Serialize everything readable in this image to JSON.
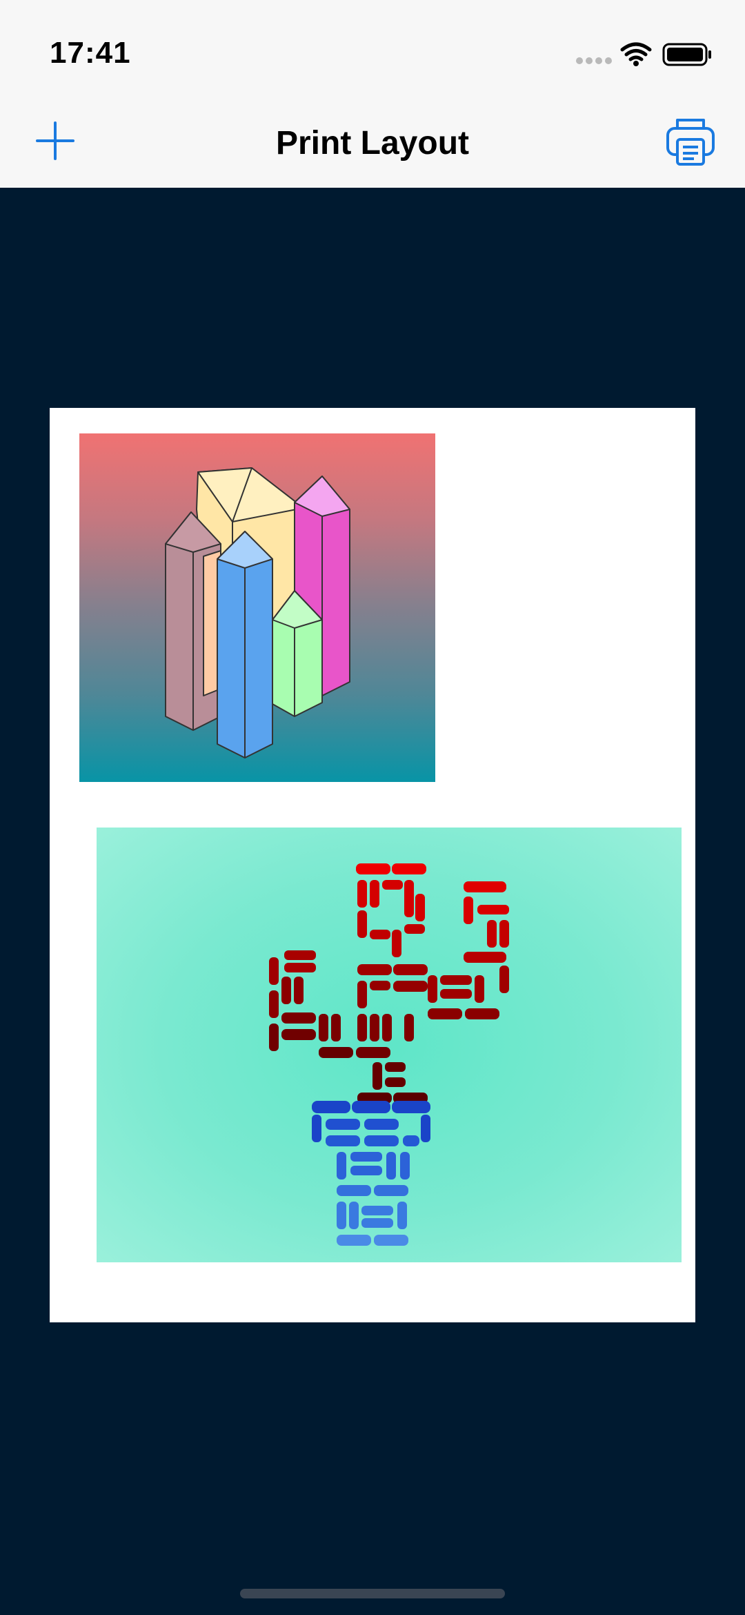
{
  "status_bar": {
    "time": "17:41",
    "icons": [
      "signal-dots-icon",
      "wifi-icon",
      "battery-icon"
    ]
  },
  "nav_bar": {
    "title": "Print Layout",
    "left_button_icon": "plus-icon",
    "right_button_icon": "printer-icon",
    "accent_color": "#1a7ae0"
  },
  "print_page": {
    "background": "#ffffff",
    "images": [
      {
        "subject": "crystal-towers-image",
        "gradient": [
          "#f07272",
          "#0894a6"
        ]
      },
      {
        "subject": "brick-cactus-image",
        "colors": [
          "#e00000",
          "#5a0000",
          "#1546c8",
          "#4a90e6"
        ],
        "background": "#6fe8cd"
      }
    ]
  },
  "colors": {
    "bars": "#f7f7f7",
    "canvas": "#001a30",
    "accent": "#1a7ae0"
  }
}
